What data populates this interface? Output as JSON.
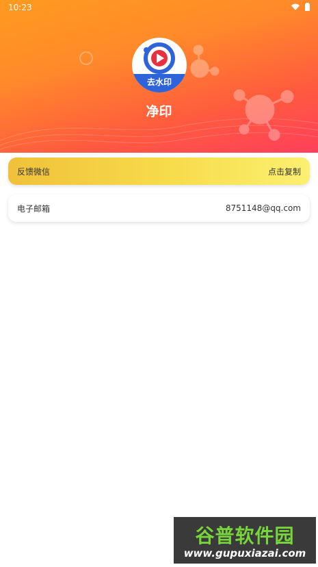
{
  "status_bar": {
    "time": "10:23"
  },
  "app": {
    "name": "净印",
    "logo_text": "去水印"
  },
  "contacts": [
    {
      "label": "反馈微信",
      "value": "点击复制"
    },
    {
      "label": "电子邮箱",
      "value": "8751148@qq.com"
    }
  ],
  "watermark": {
    "title": "谷普软件园",
    "url": "www.gupuxiazai.com"
  },
  "colors": {
    "header_orange": "#ff9a1e",
    "header_pink": "#ff3f5b",
    "logo_blue": "#2f64d8",
    "wechat_yellow": "#f7dc4b"
  }
}
